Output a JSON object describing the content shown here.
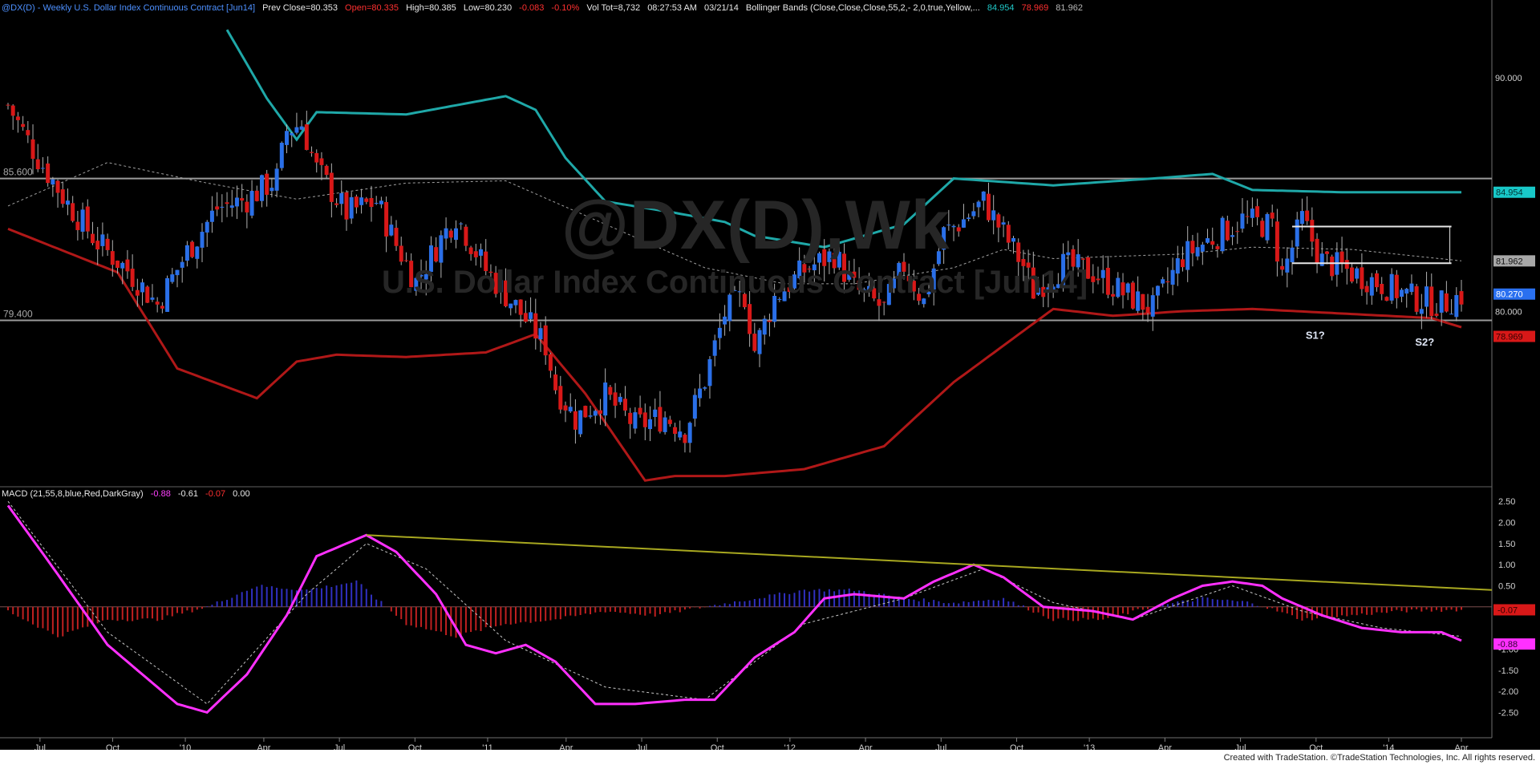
{
  "header": {
    "symbol": "@DX(D) - Weekly  U.S. Dollar Index Continuous Contract [Jun14]",
    "prev_close": "Prev Close=80.353",
    "open": "Open=80.335",
    "high": "High=80.385",
    "low": "Low=80.230",
    "change": "-0.083",
    "change_pct": "-0.10%",
    "vol": "Vol Tot=8,732",
    "time": "08:27:53 AM",
    "date": "03/21/14",
    "indicator": "Bollinger Bands (Close,Close,Close,55,2,- 2,0,true,Yellow,...",
    "upper_val": "84.954",
    "lower_val": "78.969",
    "mid_val": "81.962"
  },
  "watermark": {
    "line1": "@DX(D),Wk",
    "line2": "U.S. Dollar Index Continuous Contract [Jun14]"
  },
  "macd_header": {
    "label": "MACD (21,55,8,blue,Red,DarkGray)",
    "v1": "-0.88",
    "v2": "-0.61",
    "v3": "-0.07",
    "v4": "0.00"
  },
  "footer": "Created with TradeStation. ©TradeStation Technologies, Inc. All rights reserved.",
  "colors": {
    "up": "#2a6fe8",
    "down": "#d81818",
    "upper_band": "#1fa8a8",
    "lower_band": "#b01818",
    "mid_band": "#a0a0a0",
    "macd": "#ff30ff",
    "trendline": "#a8a820",
    "hist_pos": "#3030c0",
    "hist_neg": "#c02020"
  },
  "chart_data": [
    {
      "type": "candlestick",
      "title": "@DX(D),Wk",
      "interval": "Weekly",
      "x_tick_labels": [
        "Jul",
        "Oct",
        "'10",
        "Apr",
        "Jul",
        "Oct",
        "'11",
        "Apr",
        "Jul",
        "Oct",
        "'12",
        "Apr",
        "Jul",
        "Oct",
        "'13",
        "Apr",
        "Jul",
        "Oct",
        "'14",
        "Apr"
      ],
      "y_tick_labels": [
        "90.000",
        "85.600",
        "79.400",
        "80.000"
      ],
      "ylim": [
        72.2,
        92.7
      ],
      "horizontal_lines": [
        {
          "value": 85.6,
          "label": "85.600"
        },
        {
          "value": 79.4,
          "label": "79.400"
        }
      ],
      "annotations": [
        "S1?",
        "S2?"
      ],
      "last_price_label": "80.270",
      "close_path": [
        [
          0,
          88.8
        ],
        [
          6,
          86.5
        ],
        [
          12,
          84.5
        ],
        [
          18,
          82.8
        ],
        [
          24,
          81.6
        ],
        [
          30,
          80.1
        ],
        [
          36,
          82.4
        ],
        [
          42,
          84.3
        ],
        [
          48,
          84.7
        ],
        [
          54,
          85.6
        ],
        [
          56,
          87.7
        ],
        [
          59,
          88.0
        ],
        [
          62,
          86.0
        ],
        [
          68,
          84.1
        ],
        [
          74,
          84.6
        ],
        [
          78,
          82.7
        ],
        [
          82,
          81.1
        ],
        [
          86,
          82.6
        ],
        [
          90,
          84.0
        ],
        [
          96,
          81.6
        ],
        [
          102,
          80.0
        ],
        [
          108,
          78.3
        ],
        [
          110,
          76.5
        ],
        [
          114,
          75.1
        ],
        [
          120,
          76.1
        ],
        [
          126,
          74.8
        ],
        [
          132,
          75.2
        ],
        [
          136,
          74.6
        ],
        [
          140,
          76.8
        ],
        [
          144,
          79.7
        ],
        [
          148,
          80.5
        ],
        [
          150,
          78.1
        ],
        [
          154,
          80.4
        ],
        [
          160,
          81.6
        ],
        [
          166,
          82.3
        ],
        [
          170,
          80.8
        ],
        [
          176,
          79.9
        ],
        [
          180,
          81.8
        ],
        [
          184,
          80.2
        ],
        [
          188,
          83.2
        ],
        [
          192,
          83.8
        ],
        [
          196,
          84.6
        ],
        [
          200,
          83.2
        ],
        [
          204,
          81.8
        ],
        [
          206,
          80.7
        ],
        [
          212,
          81.8
        ],
        [
          218,
          81.5
        ],
        [
          224,
          80.6
        ],
        [
          230,
          79.9
        ],
        [
          236,
          82.2
        ],
        [
          242,
          83.0
        ],
        [
          248,
          83.8
        ],
        [
          254,
          83.5
        ],
        [
          256,
          81.4
        ],
        [
          260,
          83.8
        ],
        [
          264,
          82.0
        ],
        [
          270,
          81.5
        ],
        [
          276,
          81.0
        ],
        [
          282,
          80.4
        ],
        [
          288,
          80.1
        ],
        [
          292,
          80.5
        ]
      ]
    },
    {
      "type": "line",
      "title": "Bollinger Bands (Close,Close,Close,55,2,- 2,0,true,Yellow,...",
      "series": [
        {
          "values": [
            [
              44,
              92.1
            ],
            [
              52,
              89.1
            ],
            [
              58,
              87.3
            ],
            [
              62,
              88.5
            ],
            [
              80,
              88.4
            ],
            [
              100,
              89.2
            ],
            [
              106,
              88.6
            ],
            [
              112,
              86.5
            ],
            [
              120,
              84.6
            ],
            [
              134,
              84.1
            ],
            [
              144,
              83.7
            ],
            [
              150,
              83.1
            ],
            [
              164,
              82.6
            ],
            [
              180,
              83.6
            ],
            [
              190,
              85.6
            ],
            [
              210,
              85.3
            ],
            [
              230,
              85.6
            ],
            [
              242,
              85.8
            ],
            [
              250,
              85.1
            ],
            [
              268,
              85.0
            ],
            [
              292,
              85.0
            ]
          ]
        },
        {
          "values": [
            [
              0,
              83.4
            ],
            [
              22,
              81.5
            ],
            [
              34,
              77.3
            ],
            [
              50,
              76.0
            ],
            [
              58,
              77.6
            ],
            [
              66,
              77.9
            ],
            [
              80,
              77.8
            ],
            [
              96,
              78.0
            ],
            [
              106,
              78.8
            ],
            [
              116,
              76.2
            ],
            [
              128,
              72.4
            ],
            [
              134,
              72.6
            ],
            [
              144,
              72.6
            ],
            [
              160,
              72.9
            ],
            [
              176,
              73.9
            ],
            [
              190,
              76.7
            ],
            [
              200,
              78.3
            ],
            [
              210,
              79.9
            ],
            [
              222,
              79.6
            ],
            [
              236,
              79.8
            ],
            [
              250,
              79.9
            ],
            [
              286,
              79.5
            ],
            [
              292,
              79.1
            ]
          ]
        },
        {
          "values": [
            [
              0,
              84.4
            ],
            [
              20,
              86.3
            ],
            [
              40,
              85.4
            ],
            [
              58,
              84.7
            ],
            [
              80,
              85.4
            ],
            [
              100,
              85.5
            ],
            [
              120,
              83.6
            ],
            [
              140,
              81.7
            ],
            [
              156,
              81.0
            ],
            [
              170,
              81.0
            ],
            [
              190,
              81.7
            ],
            [
              200,
              82.5
            ],
            [
              210,
              82.1
            ],
            [
              236,
              82.3
            ],
            [
              250,
              82.6
            ],
            [
              270,
              82.5
            ],
            [
              292,
              82.0
            ]
          ]
        }
      ]
    },
    {
      "type": "line",
      "title": "MACD (21,55,8,blue,Red,DarkGray)",
      "y_tick_labels": [
        "2.50",
        "2.00",
        "1.50",
        "1.00",
        "0.50",
        "0.00",
        "-0.50",
        "-1.00",
        "-1.50",
        "-2.00",
        "-2.50"
      ],
      "ylim": [
        -3.1,
        2.75
      ],
      "series": [
        {
          "values": [
            [
              0,
              2.4
            ],
            [
              8,
              1.1
            ],
            [
              20,
              -0.9
            ],
            [
              34,
              -2.3
            ],
            [
              40,
              -2.5
            ],
            [
              48,
              -1.6
            ],
            [
              56,
              -0.2
            ],
            [
              62,
              1.2
            ],
            [
              72,
              1.7
            ],
            [
              78,
              1.3
            ],
            [
              86,
              0.3
            ],
            [
              92,
              -0.9
            ],
            [
              98,
              -1.1
            ],
            [
              104,
              -0.9
            ],
            [
              110,
              -1.3
            ],
            [
              118,
              -2.3
            ],
            [
              126,
              -2.3
            ],
            [
              136,
              -2.2
            ],
            [
              142,
              -2.2
            ],
            [
              150,
              -1.2
            ],
            [
              158,
              -0.6
            ],
            [
              164,
              0.2
            ],
            [
              170,
              0.3
            ],
            [
              180,
              0.2
            ],
            [
              186,
              0.6
            ],
            [
              194,
              1.0
            ],
            [
              200,
              0.7
            ],
            [
              208,
              0.0
            ],
            [
              218,
              -0.1
            ],
            [
              226,
              -0.3
            ],
            [
              234,
              0.2
            ],
            [
              240,
              0.5
            ],
            [
              246,
              0.6
            ],
            [
              252,
              0.5
            ],
            [
              256,
              0.2
            ],
            [
              264,
              -0.2
            ],
            [
              272,
              -0.5
            ],
            [
              280,
              -0.6
            ],
            [
              288,
              -0.6
            ],
            [
              292,
              -0.8
            ]
          ]
        },
        {
          "values": [
            [
              0,
              2.5
            ],
            [
              20,
              -0.6
            ],
            [
              40,
              -2.3
            ],
            [
              60,
              0.3
            ],
            [
              72,
              1.5
            ],
            [
              84,
              0.9
            ],
            [
              100,
              -0.8
            ],
            [
              120,
              -1.9
            ],
            [
              140,
              -2.2
            ],
            [
              160,
              -0.4
            ],
            [
              180,
              0.2
            ],
            [
              196,
              0.9
            ],
            [
              210,
              0.1
            ],
            [
              226,
              -0.3
            ],
            [
              246,
              0.5
            ],
            [
              260,
              -0.1
            ],
            [
              276,
              -0.5
            ],
            [
              292,
              -0.7
            ]
          ]
        },
        {
          "values": [
            [
              0,
              -0.1
            ],
            [
              10,
              -0.7
            ],
            [
              20,
              -0.3
            ],
            [
              30,
              -0.3
            ],
            [
              40,
              0.0
            ],
            [
              50,
              0.5
            ],
            [
              60,
              0.4
            ],
            [
              70,
              0.6
            ],
            [
              80,
              -0.4
            ],
            [
              90,
              -0.7
            ],
            [
              100,
              -0.4
            ],
            [
              110,
              -0.3
            ],
            [
              120,
              -0.1
            ],
            [
              130,
              -0.2
            ],
            [
              140,
              0.0
            ],
            [
              150,
              0.2
            ],
            [
              160,
              0.4
            ],
            [
              170,
              0.4
            ],
            [
              180,
              0.2
            ],
            [
              190,
              0.1
            ],
            [
              200,
              0.2
            ],
            [
              210,
              -0.3
            ],
            [
              220,
              -0.3
            ],
            [
              230,
              0.0
            ],
            [
              240,
              0.2
            ],
            [
              250,
              0.1
            ],
            [
              260,
              -0.3
            ],
            [
              270,
              -0.2
            ],
            [
              280,
              -0.1
            ],
            [
              292,
              -0.07
            ]
          ]
        },
        {
          "values": [
            [
              72,
              1.7
            ],
            [
              292,
              0.4
            ]
          ]
        }
      ]
    }
  ]
}
